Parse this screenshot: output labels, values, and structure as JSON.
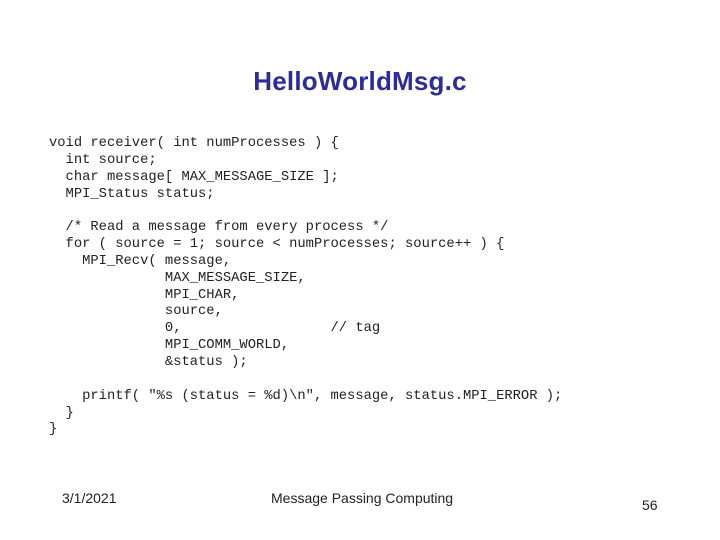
{
  "slide": {
    "title": "HelloWorldMsg.c",
    "code_lines": [
      "void receiver( int numProcesses ) {",
      "  int source;",
      "  char message[ MAX_MESSAGE_SIZE ];",
      "  MPI_Status status;",
      "",
      "  /* Read a message from every process */",
      "  for ( source = 1; source < numProcesses; source++ ) {",
      "    MPI_Recv( message,",
      "              MAX_MESSAGE_SIZE,",
      "              MPI_CHAR,",
      "              source,",
      "              0,                  // tag",
      "              MPI_COMM_WORLD,",
      "              &status );",
      "",
      "    printf( \"%s (status = %d)\\n\", message, status.MPI_ERROR );",
      "  }",
      "}"
    ]
  },
  "footer": {
    "date": "3/1/2021",
    "center_text": "Message Passing Computing",
    "page_number": "56"
  }
}
